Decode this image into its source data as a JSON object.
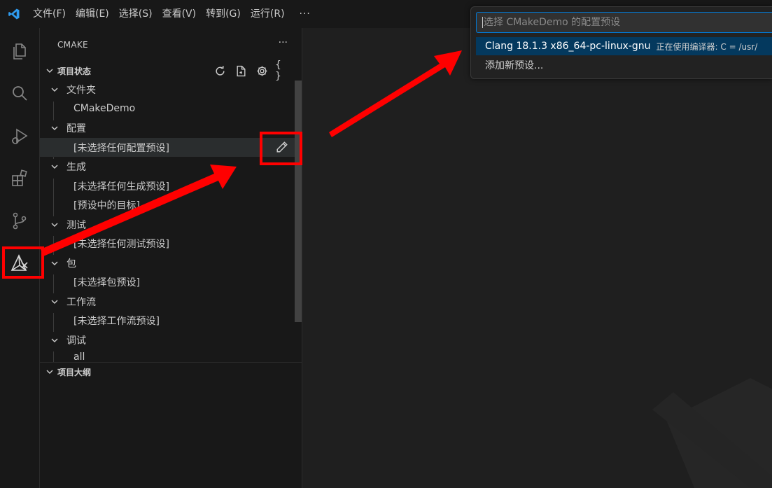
{
  "menu": {
    "items": [
      "文件(F)",
      "编辑(E)",
      "选择(S)",
      "查看(V)",
      "转到(G)",
      "运行(R)"
    ],
    "more": "···"
  },
  "activity_bar": {
    "icons": [
      "files-icon",
      "search-icon",
      "run-debug-icon",
      "extensions-icon",
      "source-control-icon",
      "cmake-icon"
    ],
    "active": "cmake-icon"
  },
  "sidebar": {
    "title": "CMAKE",
    "more": "···",
    "project_status": {
      "header": "项目状态",
      "actions": {
        "json": "{ }"
      },
      "groups": [
        {
          "label": "文件夹",
          "children": [
            "CMakeDemo"
          ]
        },
        {
          "label": "配置",
          "children": [
            "[未选择任何配置预设]"
          ]
        },
        {
          "label": "生成",
          "children": [
            "[未选择任何生成预设]",
            "[预设中的目标]"
          ]
        },
        {
          "label": "测试",
          "children": [
            "[未选择任何测试预设]"
          ]
        },
        {
          "label": "包",
          "children": [
            "[未选择包预设]"
          ]
        },
        {
          "label": "工作流",
          "children": [
            "[未选择工作流预设]"
          ]
        },
        {
          "label": "调试",
          "children": [
            "all"
          ]
        }
      ]
    },
    "project_outline": {
      "header": "项目大纲"
    }
  },
  "quick_pick": {
    "placeholder": "选择 CMakeDemo 的配置预设",
    "items": [
      {
        "label": "Clang 18.1.3 x86_64-pc-linux-gnu",
        "description": "正在使用编译器: C = /usr/",
        "active": true
      },
      {
        "label": "添加新预设...",
        "description": "",
        "active": false
      }
    ]
  },
  "colors": {
    "accent_blue": "#0078d4",
    "annotation_red": "#ff0000",
    "active_item_bg": "#04395e"
  }
}
